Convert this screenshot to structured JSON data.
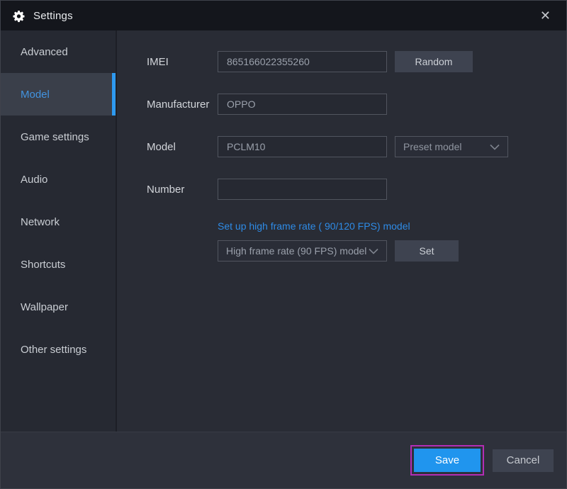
{
  "window": {
    "title": "Settings",
    "close_glyph": "✕"
  },
  "sidebar": {
    "selected": "Model",
    "items": [
      {
        "label": "Advanced"
      },
      {
        "label": "Model"
      },
      {
        "label": "Game settings"
      },
      {
        "label": "Audio"
      },
      {
        "label": "Network"
      },
      {
        "label": "Shortcuts"
      },
      {
        "label": "Wallpaper"
      },
      {
        "label": "Other settings"
      }
    ]
  },
  "form": {
    "imei": {
      "label": "IMEI",
      "value": "865166022355260",
      "random_button": "Random"
    },
    "manufacturer": {
      "label": "Manufacturer",
      "value": "OPPO"
    },
    "model": {
      "label": "Model",
      "value": "PCLM10",
      "preset_dropdown": "Preset model"
    },
    "number": {
      "label": "Number",
      "value": ""
    },
    "high_frame_rate": {
      "heading": "Set up high frame rate ( 90/120 FPS) model",
      "dropdown": "High frame rate (90 FPS) model",
      "set_button": "Set"
    }
  },
  "footer": {
    "save_label": "Save",
    "cancel_label": "Cancel"
  },
  "colors": {
    "accent_blue": "#2095ee",
    "link_blue": "#2e8be6",
    "selected_item_blue": "#4293df",
    "active_bar_blue": "#2e9af0",
    "annotation_magenta": "#b32db5"
  }
}
